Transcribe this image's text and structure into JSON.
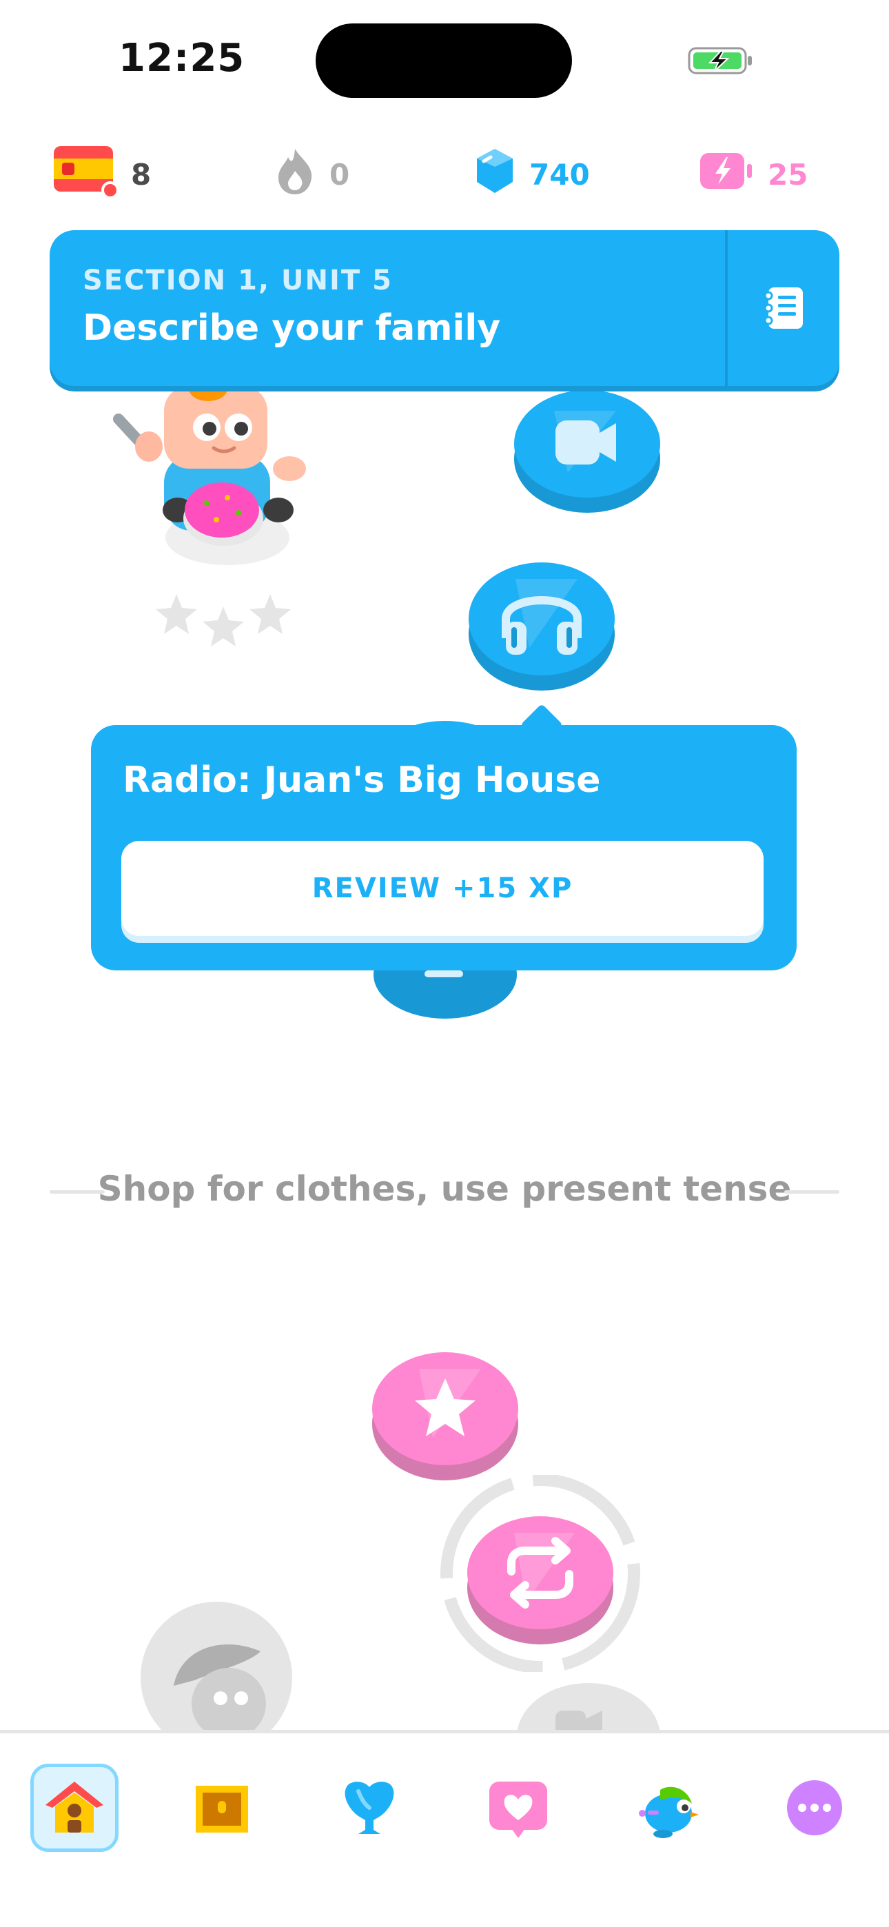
{
  "status_bar": {
    "time": "12:25",
    "battery_icon": "battery-charging-icon"
  },
  "stats": {
    "course_flag_icon": "spain-flag-icon",
    "course_count": "8",
    "streak_icon": "flame-icon",
    "streak": "0",
    "gems_icon": "gem-icon",
    "gems": "740",
    "energy_icon": "energy-battery-icon",
    "energy": "25"
  },
  "unit_banner": {
    "section": "SECTION 1, UNIT 5",
    "title": "Describe your family",
    "guidebook_icon": "guidebook-icon"
  },
  "path_nodes": [
    {
      "icon": "video-camera-icon",
      "state": "completed"
    },
    {
      "icon": "headphones-icon",
      "state": "selected"
    },
    {
      "icon": "star-icon",
      "state": "next"
    },
    {
      "icon": "practice-loop-icon",
      "state": "current"
    }
  ],
  "popover": {
    "title": "Radio: Juan's Big House",
    "button": "REVIEW +15 XP"
  },
  "next_unit": {
    "title": "Shop for clothes, use present tense"
  },
  "colors": {
    "primary": "#1cb0f6",
    "primary_shadow": "#1899d6",
    "pink": "#ff86d0",
    "gray": "#afafaf"
  },
  "bottom_nav": [
    {
      "icon": "home-icon",
      "active": true
    },
    {
      "icon": "treasure-chest-icon",
      "active": false
    },
    {
      "icon": "league-shield-icon",
      "active": false
    },
    {
      "icon": "heart-chat-icon",
      "active": false
    },
    {
      "icon": "duo-bird-icon",
      "active": false
    },
    {
      "icon": "more-icon",
      "active": false
    }
  ]
}
